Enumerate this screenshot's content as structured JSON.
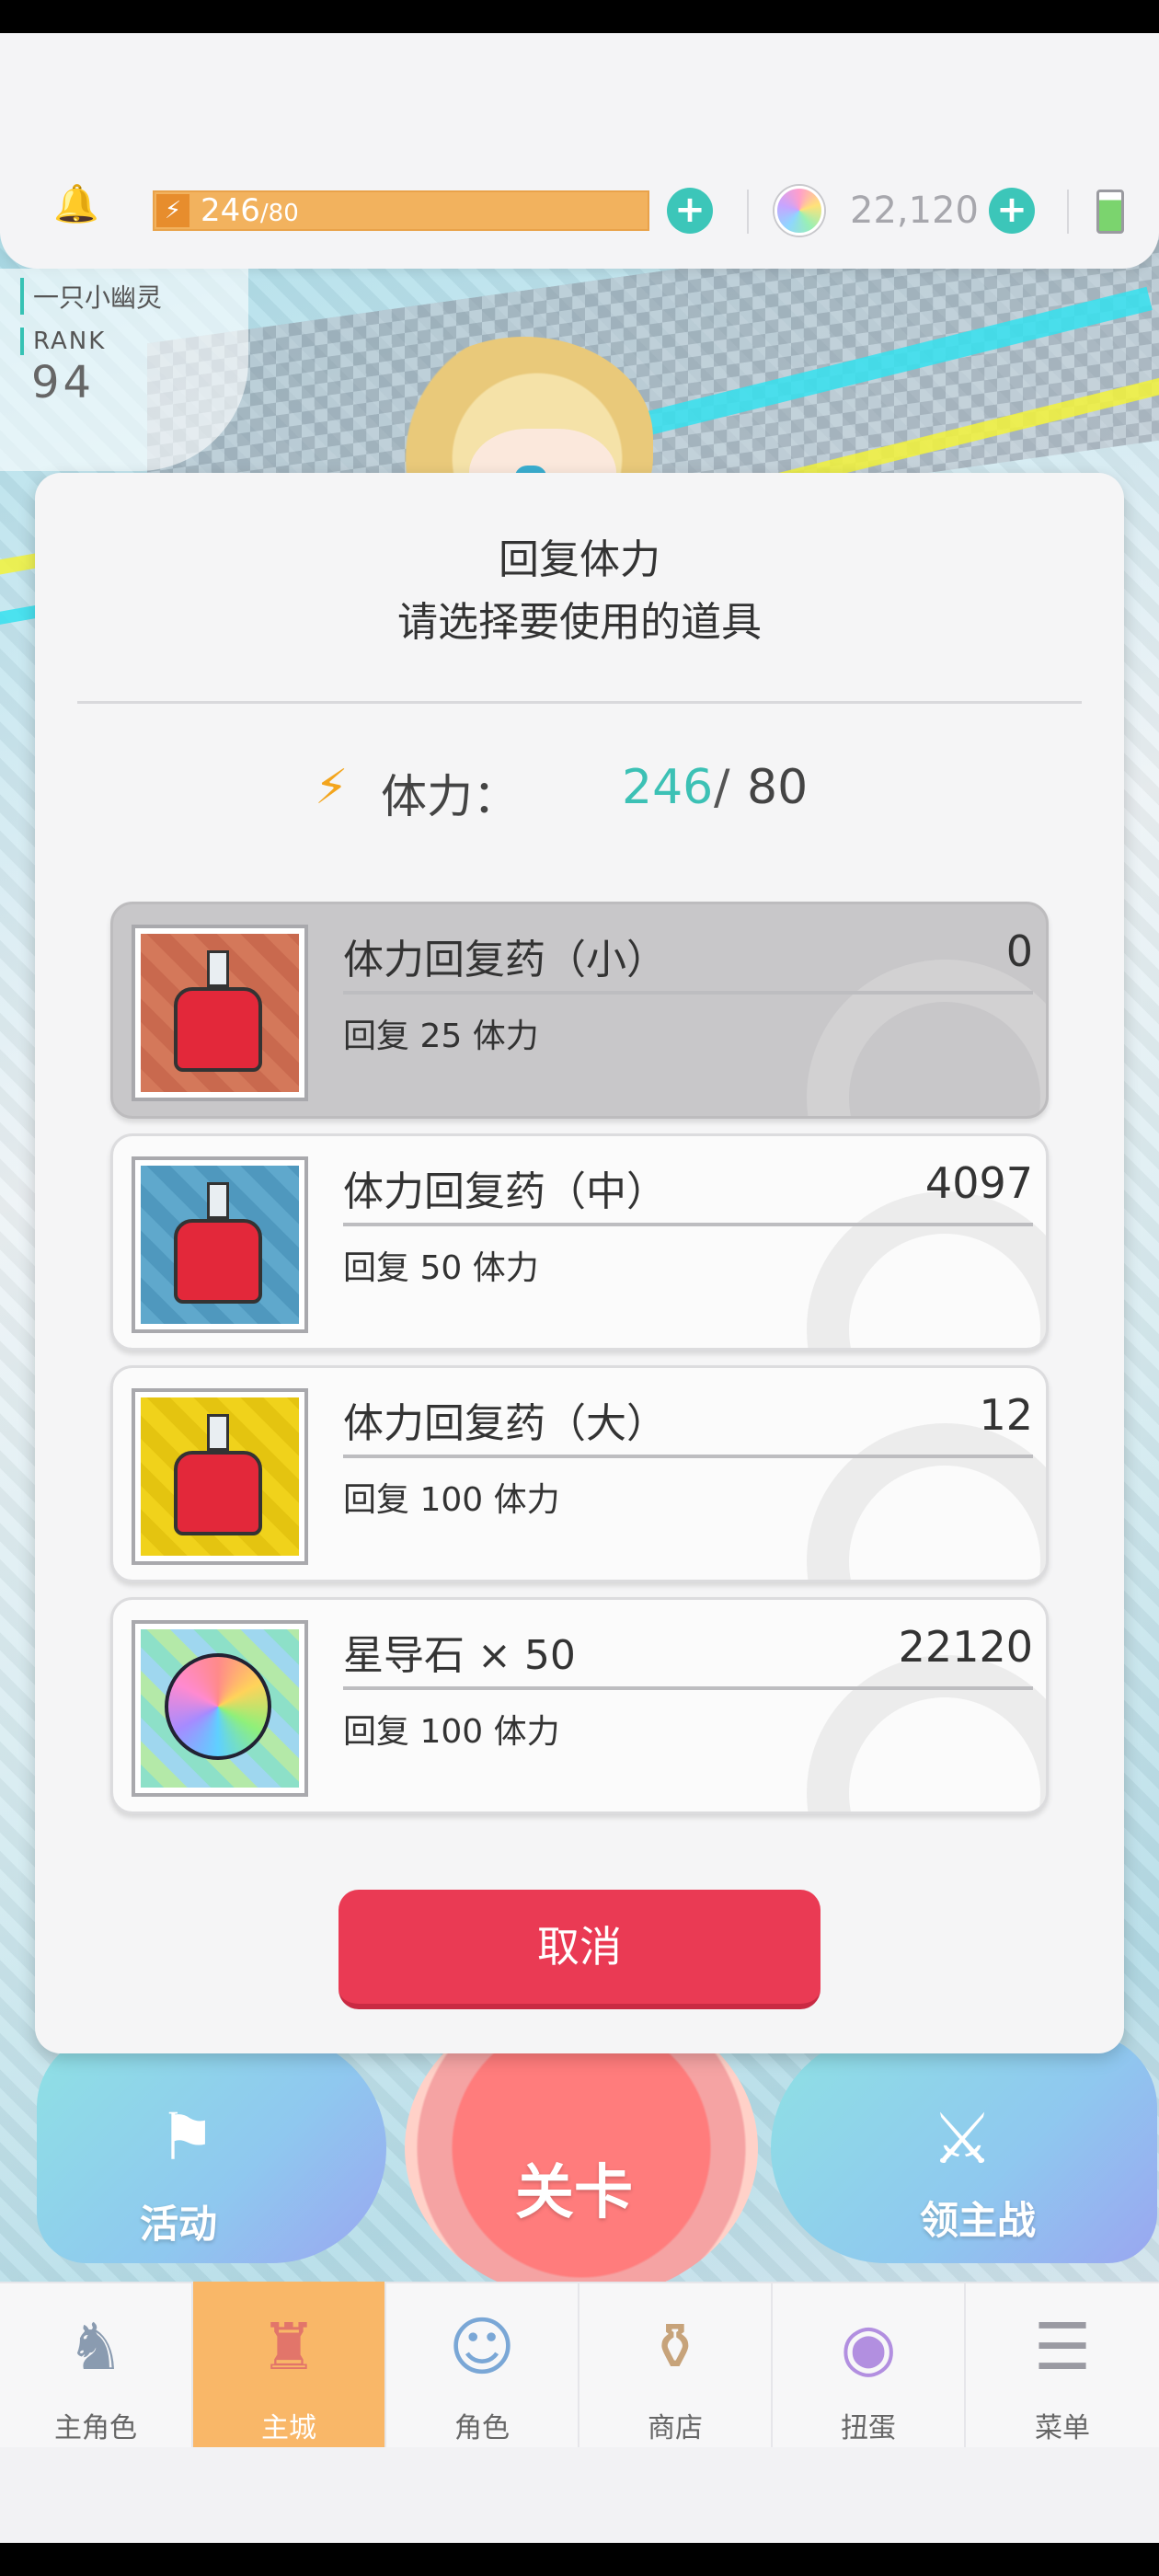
{
  "hud": {
    "stamina_current": "246",
    "stamina_max": "/80",
    "gem_count": "22,120",
    "icons": [
      "bell-icon",
      "lightning-icon",
      "plus-icon",
      "gem-icon",
      "battery-icon"
    ]
  },
  "player": {
    "name": "一只小幽灵",
    "rank_label": "RANK",
    "rank_value": "94"
  },
  "modal": {
    "title": "回复体力",
    "subtitle": "请选择要使用的道具",
    "stamina_label": "体力：",
    "stamina_current": "246",
    "stamina_slash": "/",
    "stamina_max": "80",
    "items": [
      {
        "name": "体力回复药（小）",
        "count": "0",
        "desc": "回复 25 体力",
        "disabled": true
      },
      {
        "name": "体力回复药（中）",
        "count": "4097",
        "desc": "回复 50 体力",
        "disabled": false
      },
      {
        "name": "体力回复药（大）",
        "count": "12",
        "desc": "回复 100 体力",
        "disabled": false
      },
      {
        "name": "星导石 × 50",
        "count": "22120",
        "desc": "回复 100 体力",
        "disabled": false
      }
    ],
    "cancel_label": "取消"
  },
  "game_buttons": {
    "event": "活动",
    "stage": "关卡",
    "boss": "领主战"
  },
  "tabs": [
    {
      "label": "主角色",
      "active": false
    },
    {
      "label": "主城",
      "active": true
    },
    {
      "label": "角色",
      "active": false
    },
    {
      "label": "商店",
      "active": false
    },
    {
      "label": "扭蛋",
      "active": false
    },
    {
      "label": "菜单",
      "active": false
    }
  ],
  "colors": {
    "accent_teal": "#3cc1b5",
    "cancel_red": "#ea3a54",
    "stamina_orange": "#f2b25e",
    "active_tab": "#f9b768"
  }
}
